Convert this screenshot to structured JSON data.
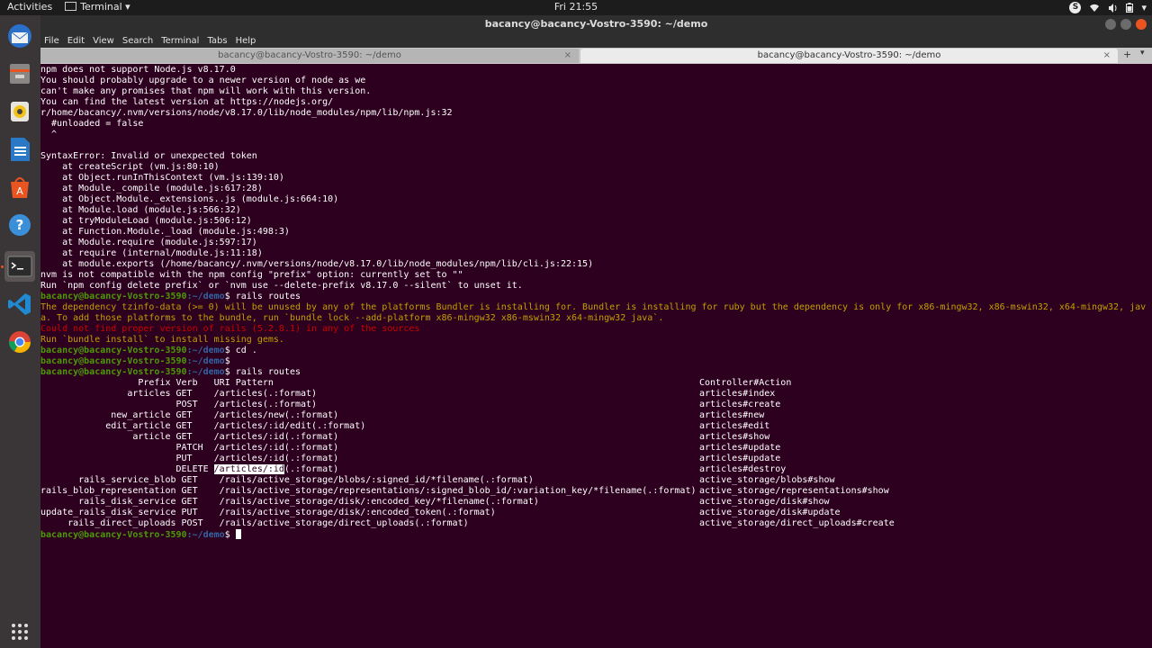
{
  "topbar": {
    "activities": "Activities",
    "app_menu": "Terminal ▾",
    "clock": "Fri 21:55",
    "tray": {
      "skype": "S",
      "wifi": "wifi-icon",
      "volume": "volume-icon",
      "battery": "battery-icon",
      "menu": "▾"
    }
  },
  "window": {
    "title": "bacancy@bacancy-Vostro-3590: ~/demo",
    "menu": [
      "File",
      "Edit",
      "View",
      "Search",
      "Terminal",
      "Tabs",
      "Help"
    ],
    "tabs": [
      {
        "label": "bacancy@bacancy-Vostro-3590: ~/demo",
        "active": false
      },
      {
        "label": "bacancy@bacancy-Vostro-3590: ~/demo",
        "active": true
      }
    ],
    "new_tab": "+",
    "tab_menu": "▾"
  },
  "dock": [
    "thunderbird-icon",
    "files-icon",
    "rhythmbox-icon",
    "writer-icon",
    "software-icon",
    "help-icon",
    "terminal-icon",
    "vscode-icon",
    "chrome-icon"
  ],
  "terminal": {
    "prompt_user": "bacancy@bacancy-Vostro-3590",
    "prompt_path": ":~/demo",
    "lines": [
      "npm does not support Node.js v8.17.0",
      "You should probably upgrade to a newer version of node as we",
      "can't make any promises that npm will work with this version.",
      "You can find the latest version at https://nodejs.org/",
      "r/home/bacancy/.nvm/versions/node/v8.17.0/lib/node_modules/npm/lib/npm.js:32",
      "  #unloaded = false",
      "  ^",
      "",
      "SyntaxError: Invalid or unexpected token",
      "    at createScript (vm.js:80:10)",
      "    at Object.runInThisContext (vm.js:139:10)",
      "    at Module._compile (module.js:617:28)",
      "    at Object.Module._extensions..js (module.js:664:10)",
      "    at Module.load (module.js:566:32)",
      "    at tryModuleLoad (module.js:506:12)",
      "    at Function.Module._load (module.js:498:3)",
      "    at Module.require (module.js:597:17)",
      "    at require (internal/module.js:11:18)",
      "    at module.exports (/home/bacancy/.nvm/versions/node/v8.17.0/lib/node_modules/npm/lib/cli.js:22:15)",
      "nvm is not compatible with the npm config \"prefix\" option: currently set to \"\"",
      "Run `npm config delete prefix` or `nvm use --delete-prefix v8.17.0 --silent` to unset it."
    ],
    "cmd1": "$ rails routes",
    "warn1": "The dependency tzinfo-data (>= 0) will be unused by any of the platforms Bundler is installing for. Bundler is installing for ruby but the dependency is only for x86-mingw32, x86-mswin32, x64-mingw32, jav",
    "warn2": "a. To add those platforms to the bundle, run `bundle lock --add-platform x86-mingw32 x86-mswin32 x64-mingw32 java`.",
    "err1": "Could not find proper version of rails (5.2.8.1) in any of the sources",
    "warn3": "Run `bundle install` to install missing gems.",
    "cmd2": "$ cd .",
    "cmd3": "$",
    "cmd4": "$ rails routes",
    "cmd5": "$ ",
    "routes_header": {
      "left": "                  Prefix Verb   URI Pattern",
      "right": "Controller#Action"
    },
    "routes": [
      {
        "left": "                articles GET    /articles(.:format)",
        "right": "articles#index"
      },
      {
        "left": "                         POST   /articles(.:format)",
        "right": "articles#create"
      },
      {
        "left": "             new_article GET    /articles/new(.:format)",
        "right": "articles#new"
      },
      {
        "left": "            edit_article GET    /articles/:id/edit(.:format)",
        "right": "articles#edit"
      },
      {
        "left": "                 article GET    /articles/:id(.:format)",
        "right": "articles#show"
      },
      {
        "left": "                         PATCH  /articles/:id(.:format)",
        "right": "articles#update"
      },
      {
        "left": "                         PUT    /articles/:id(.:format)",
        "right": "articles#update"
      },
      {
        "left_pre": "                         DELETE ",
        "left_hl": "/articles/:id",
        "left_post": "(.:format)",
        "right": "articles#destroy"
      },
      {
        "left": "       rails_service_blob GET    /rails/active_storage/blobs/:signed_id/*filename(.:format)",
        "right": "active_storage/blobs#show"
      },
      {
        "left": "rails_blob_representation GET    /rails/active_storage/representations/:signed_blob_id/:variation_key/*filename(.:format)",
        "right": "active_storage/representations#show"
      },
      {
        "left": "       rails_disk_service GET    /rails/active_storage/disk/:encoded_key/*filename(.:format)",
        "right": "active_storage/disk#show"
      },
      {
        "left": "update_rails_disk_service PUT    /rails/active_storage/disk/:encoded_token(.:format)",
        "right": "active_storage/disk#update"
      },
      {
        "left": "     rails_direct_uploads POST   /rails/active_storage/direct_uploads(.:format)",
        "right": "active_storage/direct_uploads#create"
      }
    ]
  }
}
